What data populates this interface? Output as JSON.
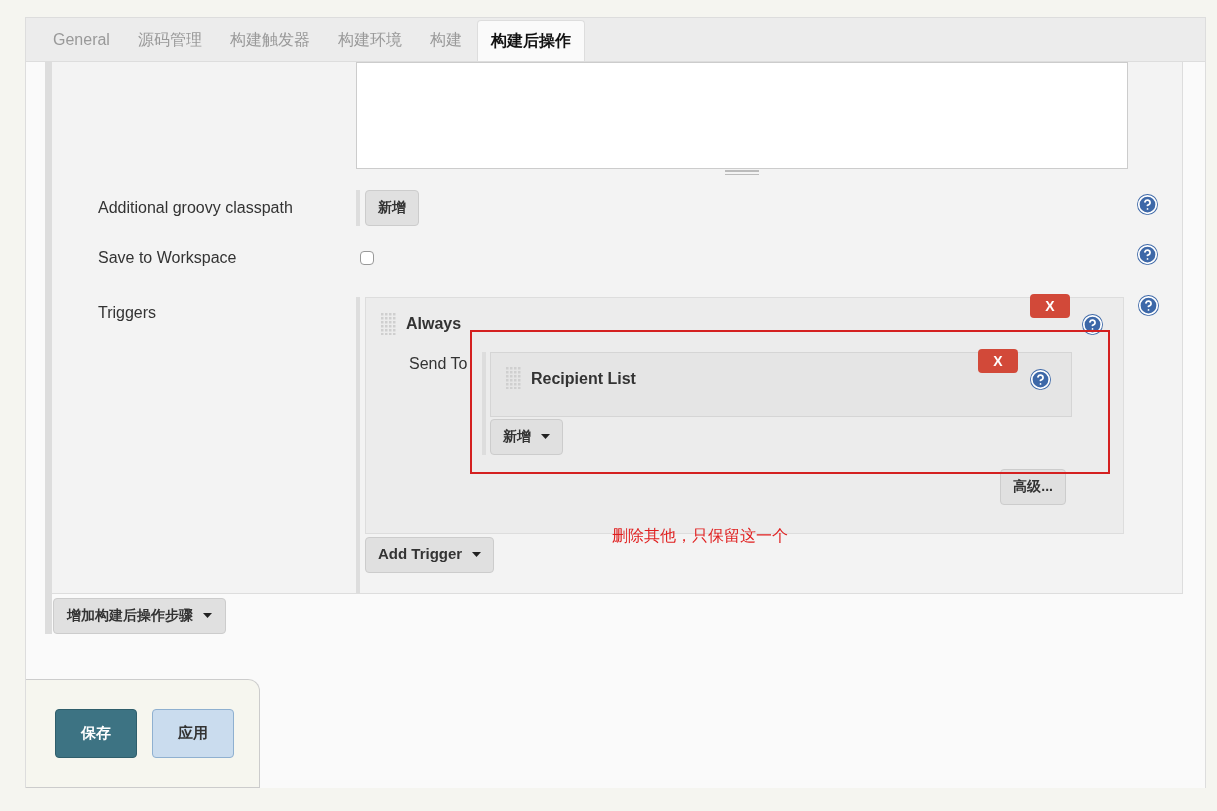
{
  "tabs": [
    {
      "label": "General",
      "selected": false
    },
    {
      "label": "源码管理",
      "selected": false
    },
    {
      "label": "构建触发器",
      "selected": false
    },
    {
      "label": "构建环境",
      "selected": false
    },
    {
      "label": "构建",
      "selected": false
    },
    {
      "label": "构建后操作",
      "selected": true
    }
  ],
  "rows": [
    {
      "kind": "textarea"
    },
    {
      "kind": "button",
      "label": "Additional groovy classpath",
      "button": "新增"
    },
    {
      "kind": "checkbox",
      "label": "Save to Workspace",
      "checked": false
    },
    {
      "kind": "triggers",
      "label": "Triggers"
    }
  ],
  "trigger": {
    "name": "Always",
    "delete": "X",
    "send_to": "Send To",
    "recipients": [
      {
        "name": "Recipient List",
        "delete": "X"
      }
    ],
    "add": "新增",
    "advanced": "高级...",
    "add_trigger": "Add Trigger"
  },
  "annotation": "删除其他，只保留这一个",
  "add_step": "增加构建后操作步骤",
  "buttons": [
    {
      "kind": "primary",
      "label": "保存"
    },
    {
      "kind": "secondary",
      "label": "应用"
    }
  ]
}
